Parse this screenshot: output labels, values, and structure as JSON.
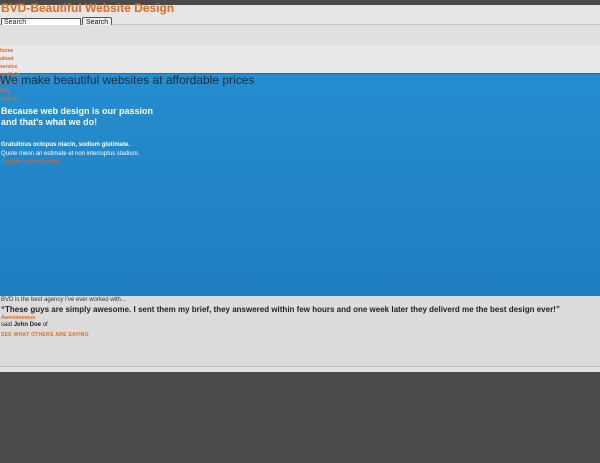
{
  "header": {
    "site_title": "BVD-Beautiful Website Design",
    "search_value": "Search",
    "search_button_label": "Search"
  },
  "nav": {
    "items": [
      "home",
      "about",
      "service",
      "portfolio",
      "contact",
      "blog",
      "support"
    ]
  },
  "hero": {
    "heading": "We make beautiful websites at affordable prices",
    "tagline_line1": "Because web design is our passion",
    "tagline_line2": "and that's what we do!",
    "feature_title": "Gratuitous octopus niacin, sodium glutimate.",
    "feature_text": "Quote meon an estimate et non interruptus stadium.",
    "feature_link": "Read the rest of this article"
  },
  "testimonials": {
    "intro": "BVD is the best agency I've ever worked with...",
    "quote": "“These guys are simply awesome. I sent them my brief, they answered within few hours and one week later they deliverd me the best design ever!”",
    "badge": "Awesomeness",
    "said_prefix": "said",
    "author": "John Doe",
    "said_suffix": "of",
    "more_link": "SEE WHAT OTHERS ARE SAYING"
  },
  "colors": {
    "accent": "#e06a1e",
    "hero_blue": "#258ed0",
    "dark": "#4a4b49"
  }
}
